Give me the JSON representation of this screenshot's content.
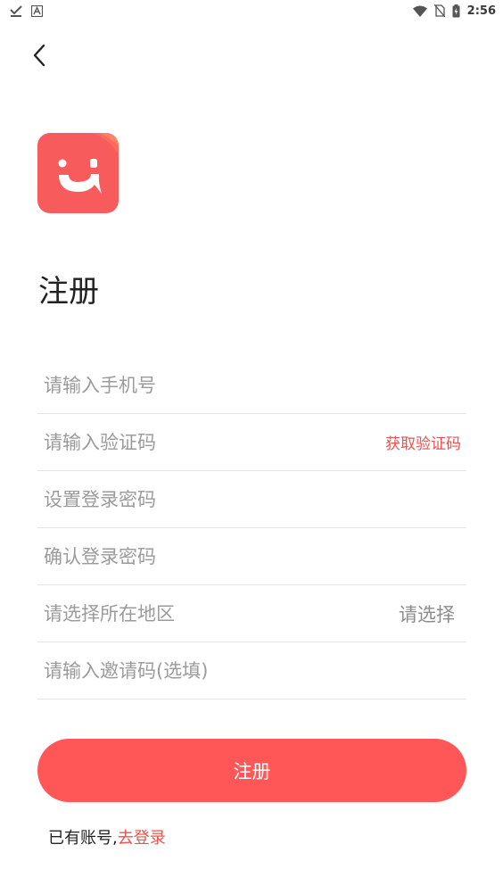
{
  "status_bar": {
    "time": "2:56",
    "left_icons": [
      "download-done-icon",
      "a-notification-icon"
    ],
    "right_icons": [
      "wifi-icon",
      "no-sim-icon",
      "battery-charging-icon"
    ]
  },
  "header": {
    "back_icon": "chevron-left-icon"
  },
  "logo": {
    "icon": "smile-chat-logo",
    "color": "#f85b5b"
  },
  "title": "注册",
  "form": {
    "phone_placeholder": "请输入手机号",
    "code_placeholder": "请输入验证码",
    "get_code_label": "获取验证码",
    "password_placeholder": "设置登录密码",
    "confirm_password_placeholder": "确认登录密码",
    "region_placeholder": "请选择所在地区",
    "region_select_label": "请选择",
    "invite_placeholder": "请输入邀请码(选填)"
  },
  "submit_label": "注册",
  "footer": {
    "has_account_text": "已有账号,",
    "login_link": "去登录"
  },
  "colors": {
    "accent": "#ff5757",
    "link": "#f0504f",
    "divider": "#e2e2e2",
    "placeholder": "#9b9b9b"
  }
}
